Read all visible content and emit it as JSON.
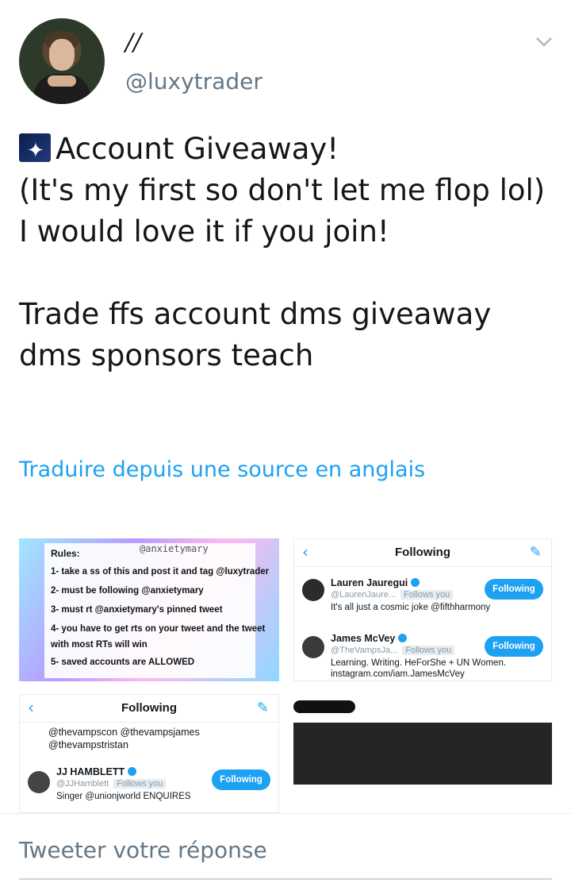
{
  "author": {
    "name": "//",
    "handle": "@luxytrader"
  },
  "icons": {
    "avatar": "profile-photo",
    "menu": "chevron-down-icon",
    "emoji": "sparkle-night-icon"
  },
  "tweet": {
    "lines": [
      "Account Giveaway!",
      "(It's my first so don't let me flop lol)",
      "I would love it if you join!",
      "",
      "Trade ffs account dms giveaway dms sponsors teach"
    ]
  },
  "translate_link": "Traduire depuis une source en anglais",
  "media": {
    "rules_image": {
      "title": "Rules:",
      "tag": "@anxietymary",
      "rules": [
        "1- take a ss of this and post it and tag @luxytrader",
        "2- must be following @anxietymary",
        "3- must rt @anxietymary's pinned tweet",
        "4- you have to get rts on your tweet and the tweet",
        "with most RTs will win",
        "5- saved accounts are ALLOWED"
      ]
    },
    "following_1": {
      "header": "Following",
      "users": [
        {
          "name": "Lauren Jauregui",
          "handle": "@LaurenJaure...",
          "follows_you": "Follows you",
          "bio": "It's all just a cosmic joke @fifthharmony",
          "button": "Following"
        },
        {
          "name": "James McVey",
          "handle": "@TheVampsJa...",
          "follows_you": "Follows you",
          "bio": "Learning. Writing. HeForShe + UN Women.",
          "bio2": "instagram.com/iam.JamesMcVey",
          "button": "Following"
        }
      ]
    },
    "following_2": {
      "header": "Following",
      "lines": [
        "@thevampscon @thevampsjames",
        "@thevampstristan"
      ],
      "user": {
        "name": "JJ HAMBLETT",
        "handle": "@JJHamblett",
        "follows_you": "Follows you",
        "bio": "Singer @unionjworld ENQUIRES",
        "button": "Following"
      }
    }
  },
  "reply_placeholder": "Tweeter votre réponse",
  "colors": {
    "link": "#1da1f2",
    "muted": "#657786",
    "text": "#14171a"
  }
}
